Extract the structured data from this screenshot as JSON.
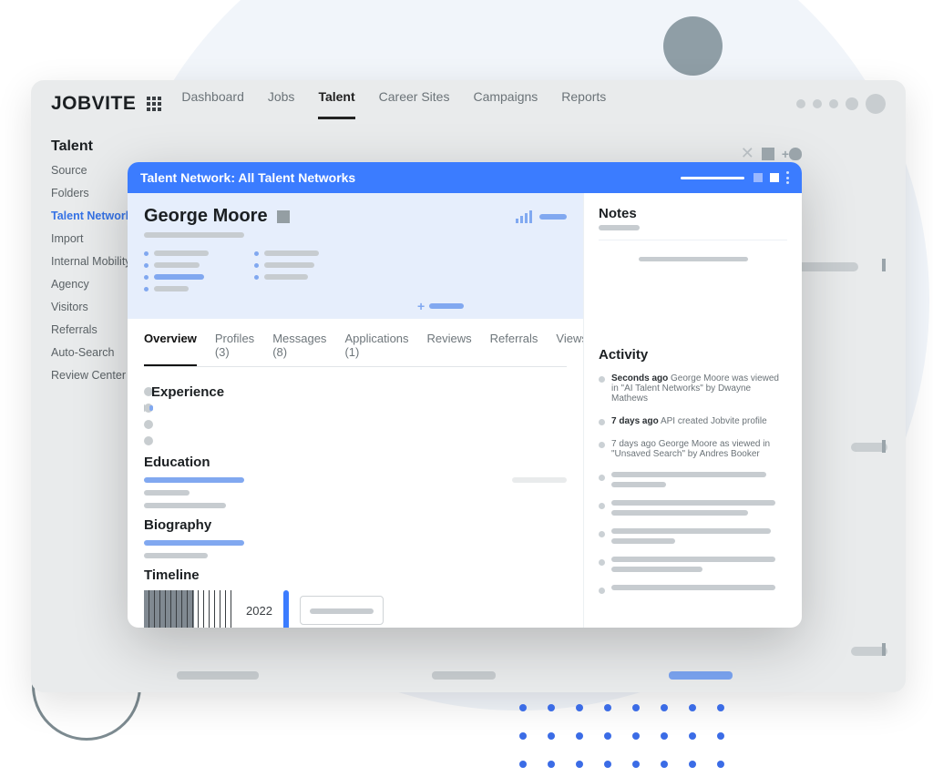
{
  "brand": "JOBVITE",
  "nav": {
    "dashboard": "Dashboard",
    "jobs": "Jobs",
    "talent": "Talent",
    "career_sites": "Career Sites",
    "campaigns": "Campaigns",
    "reports": "Reports"
  },
  "sidebar": {
    "title": "Talent",
    "items": [
      "Source",
      "Folders",
      "Talent Network",
      "Import",
      "Internal Mobility",
      "Agency",
      "Visitors",
      "Referrals",
      "Auto-Search",
      "Review Center"
    ],
    "active_index": 2
  },
  "modal": {
    "header": "Talent Network: All Talent Networks",
    "name": "George Moore",
    "tabs": {
      "overview": "Overview",
      "profiles": "Profiles (3)",
      "messages": "Messages (8)",
      "applications": "Applications (1)",
      "reviews": "Reviews",
      "referrals": "Referrals",
      "views": "Views"
    },
    "sections": {
      "experience": "Experience",
      "education": "Education",
      "biography": "Biography",
      "timeline": "Timeline"
    },
    "timeline_year": "2022",
    "right": {
      "notes": "Notes",
      "activity": "Activity",
      "items": [
        {
          "time": "Seconds ago",
          "text": "George Moore was viewed in \"AI Talent Networks\" by Dwayne Mathews"
        },
        {
          "time": "7 days ago",
          "text": "API created Jobvite profile"
        },
        {
          "time": "7 days ago",
          "text": "George Moore as viewed in \"Unsaved Search\" by Andres Booker"
        }
      ]
    }
  }
}
